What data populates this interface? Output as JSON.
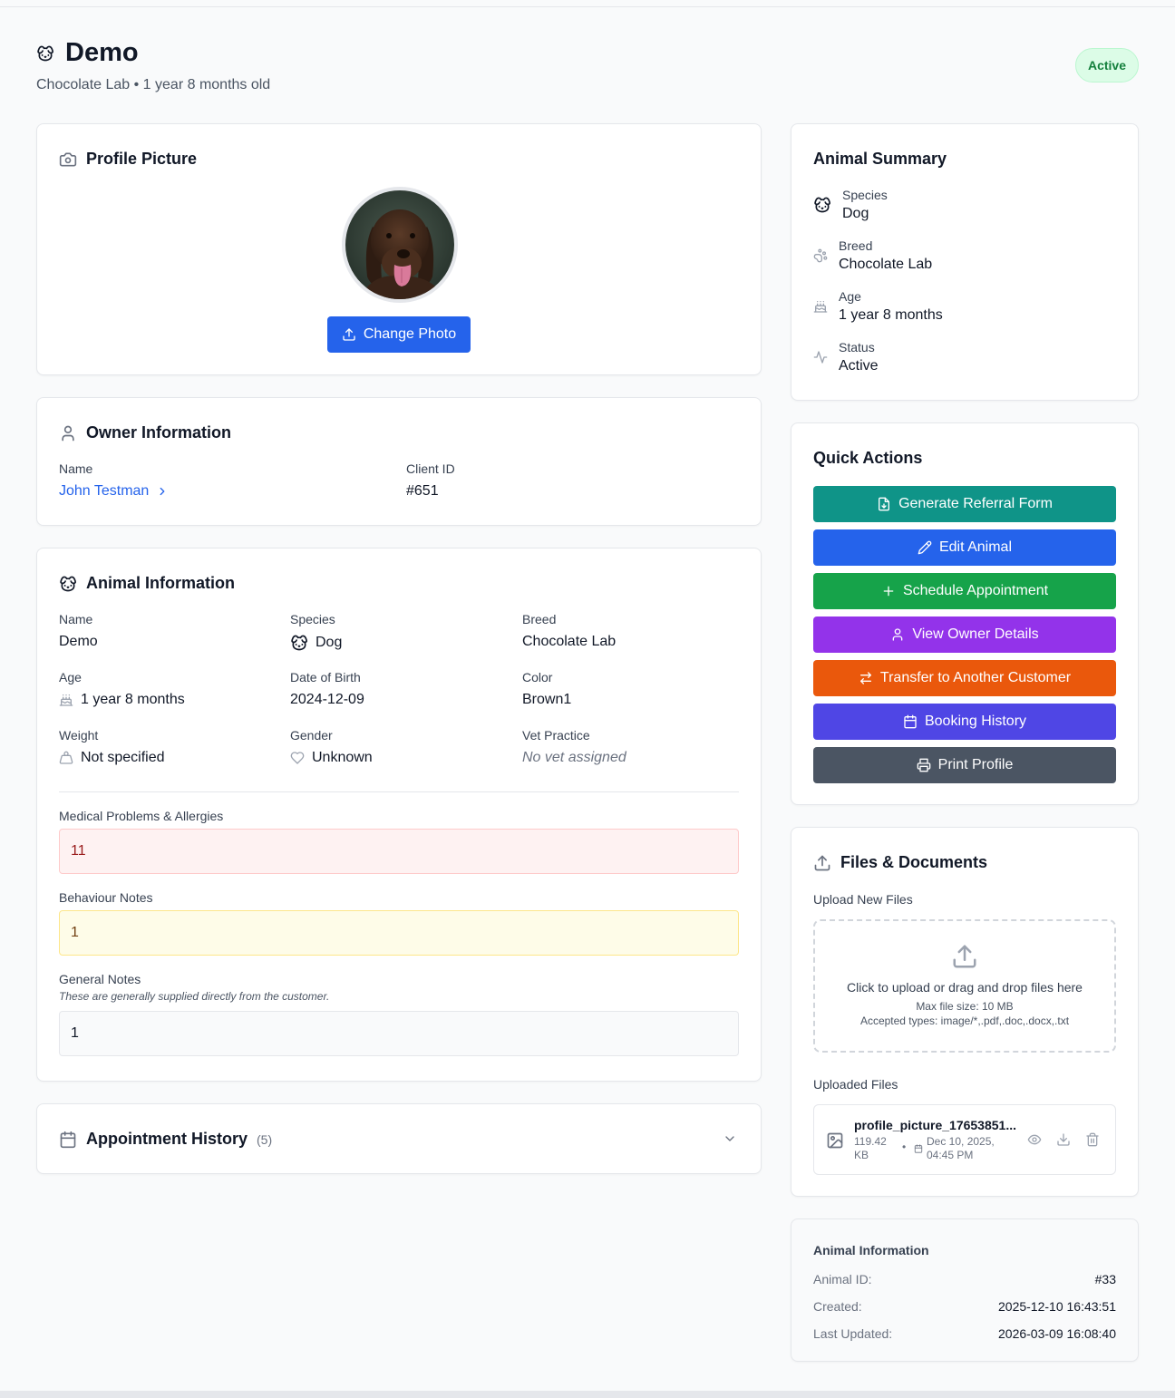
{
  "header": {
    "title": "Demo",
    "subtitle": "Chocolate Lab • 1 year 8 months old",
    "status": "Active"
  },
  "profile_picture": {
    "title": "Profile Picture",
    "change_photo_label": "Change Photo"
  },
  "owner": {
    "title": "Owner Information",
    "name_label": "Name",
    "name_value": "John Testman",
    "client_id_label": "Client ID",
    "client_id_value": "#651"
  },
  "animal_info": {
    "title": "Animal Information",
    "name_label": "Name",
    "name_value": "Demo",
    "species_label": "Species",
    "species_value": "Dog",
    "breed_label": "Breed",
    "breed_value": "Chocolate Lab",
    "age_label": "Age",
    "age_value": "1 year 8 months",
    "dob_label": "Date of Birth",
    "dob_value": "2024-12-09",
    "color_label": "Color",
    "color_value": "Brown1",
    "weight_label": "Weight",
    "weight_value": "Not specified",
    "gender_label": "Gender",
    "gender_value": "Unknown",
    "vet_label": "Vet Practice",
    "vet_value": "No vet assigned",
    "medical_label": "Medical Problems & Allergies",
    "medical_value": "11",
    "behaviour_label": "Behaviour Notes",
    "behaviour_value": "1",
    "general_label": "General Notes",
    "general_hint": "These are generally supplied directly from the customer.",
    "general_value": "1"
  },
  "appointment_history": {
    "title": "Appointment History",
    "count": "(5)"
  },
  "summary": {
    "title": "Animal Summary",
    "species_label": "Species",
    "species_value": "Dog",
    "breed_label": "Breed",
    "breed_value": "Chocolate Lab",
    "age_label": "Age",
    "age_value": "1 year 8 months",
    "status_label": "Status",
    "status_value": "Active"
  },
  "quick_actions": {
    "title": "Quick Actions",
    "referral": "Generate Referral Form",
    "edit": "Edit Animal",
    "schedule": "Schedule Appointment",
    "view_owner": "View Owner Details",
    "transfer": "Transfer to Another Customer",
    "booking": "Booking History",
    "print": "Print Profile"
  },
  "files": {
    "title": "Files & Documents",
    "upload_label": "Upload New Files",
    "dropzone_text": "Click to upload or drag and drop files here",
    "max_size": "Max file size: 10 MB",
    "accepted": "Accepted types: image/*,.pdf,.doc,.docx,.txt",
    "uploaded_label": "Uploaded Files",
    "file_name": "profile_picture_17653851...",
    "file_size_line1": "119.42",
    "file_size_line2": "KB",
    "file_date_line1": "Dec 10, 2025,",
    "file_date_line2": "04:45 PM"
  },
  "meta": {
    "title": "Animal Information",
    "id_label": "Animal ID:",
    "id_value": "#33",
    "created_label": "Created:",
    "created_value": "2025-12-10 16:43:51",
    "updated_label": "Last Updated:",
    "updated_value": "2026-03-09 16:08:40"
  },
  "colors": {
    "teal": "#0f9488",
    "blue": "#2563eb",
    "green": "#16a34a",
    "purple": "#9333ea",
    "orange": "#ea580c",
    "indigo": "#4f46e5",
    "gray": "#4b5563"
  }
}
